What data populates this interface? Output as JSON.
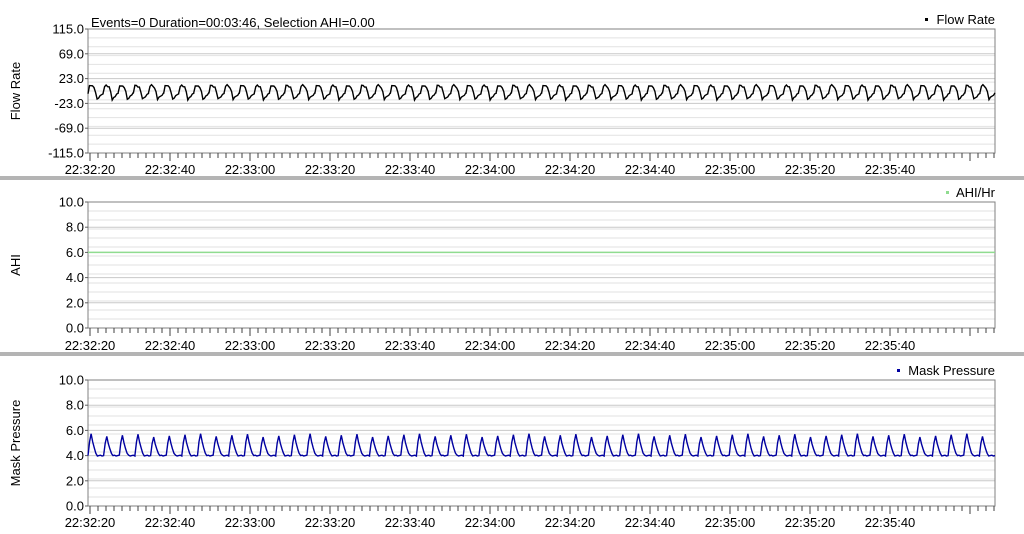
{
  "header": {
    "info_text": "Events=0 Duration=00:03:46, Selection AHI=0.00"
  },
  "x_tick_labels": [
    "22:32:20",
    "22:32:40",
    "22:33:00",
    "22:33:20",
    "22:33:40",
    "22:34:00",
    "22:34:20",
    "22:34:40",
    "22:35:00",
    "22:35:20",
    "22:35:40"
  ],
  "chart_data": [
    {
      "type": "line",
      "ylabel": "Flow Rate",
      "ylim": [
        -115.0,
        115.0
      ],
      "yticks": [
        "115.0",
        "69.0",
        "23.0",
        "-23.0",
        "-69.0",
        "-115.0"
      ],
      "ytick_values": [
        115,
        69,
        23,
        -23,
        -69,
        -115
      ],
      "series": [
        {
          "name": "Flow Rate",
          "color": "#000000",
          "waveform": "breath",
          "baseline": -4,
          "amplitude_high": 12,
          "amplitude_low": -16
        }
      ],
      "breaths": 60,
      "grid": true,
      "legend": "top-right"
    },
    {
      "type": "line",
      "ylabel": "AHI",
      "ylim": [
        0.0,
        10.0
      ],
      "yticks": [
        "10.0",
        "8.0",
        "6.0",
        "4.0",
        "2.0",
        "0.0"
      ],
      "ytick_values": [
        10,
        8,
        6,
        4,
        2,
        0
      ],
      "series": [
        {
          "name": "AHI/Hr",
          "color": "#90dc90",
          "waveform": "constant",
          "value": 6.0
        }
      ],
      "grid": true,
      "legend": "top-right"
    },
    {
      "type": "line",
      "ylabel": "Mask Pressure",
      "ylim": [
        0.0,
        10.0
      ],
      "yticks": [
        "10.0",
        "8.0",
        "6.0",
        "4.0",
        "2.0",
        "0.0"
      ],
      "ytick_values": [
        10,
        8,
        6,
        4,
        2,
        0
      ],
      "series": [
        {
          "name": "Mask Pressure",
          "color": "#0000a0",
          "waveform": "pressure",
          "base": 4.0,
          "peak": 6.0
        }
      ],
      "breaths": 58,
      "grid": true,
      "legend": "top-right"
    }
  ]
}
